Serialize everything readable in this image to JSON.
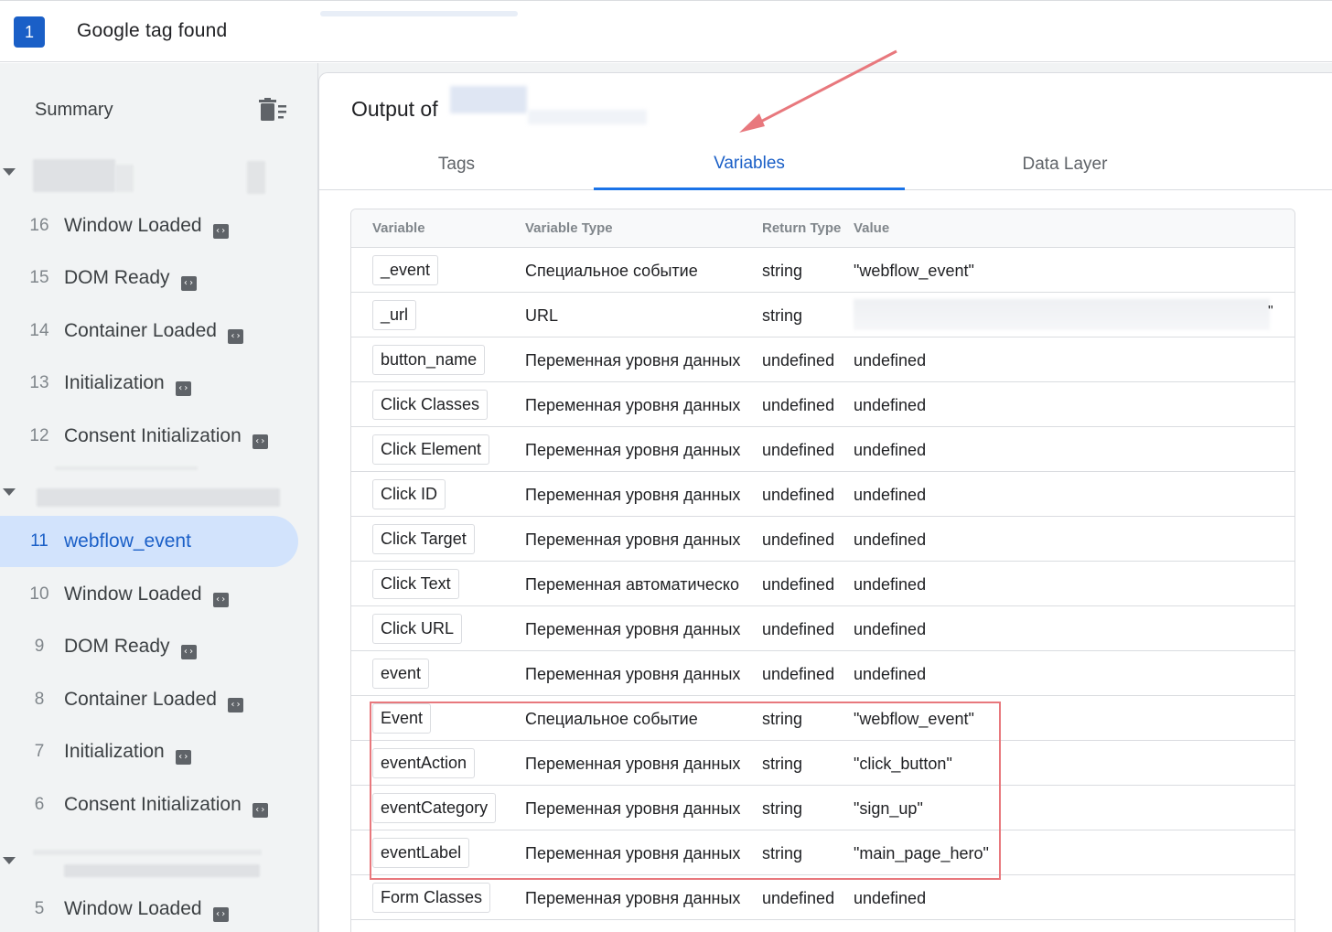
{
  "header": {
    "badge": "1",
    "title": "Google tag found"
  },
  "sidebar": {
    "summary_label": "Summary",
    "events": [
      {
        "num": "16",
        "name": "Window Loaded",
        "icon": "tag-icon"
      },
      {
        "num": "15",
        "name": "DOM Ready",
        "icon": "tag-icon"
      },
      {
        "num": "14",
        "name": "Container Loaded",
        "icon": "tag-icon"
      },
      {
        "num": "13",
        "name": "Initialization",
        "icon": "tag-icon"
      },
      {
        "num": "12",
        "name": "Consent Initialization",
        "icon": "tag-icon"
      },
      {
        "num": "11",
        "name": "webflow_event",
        "selected": true
      },
      {
        "num": "10",
        "name": "Window Loaded",
        "icon": "tag-icon"
      },
      {
        "num": "9",
        "name": "DOM Ready",
        "icon": "tag-icon"
      },
      {
        "num": "8",
        "name": "Container Loaded",
        "icon": "tag-icon"
      },
      {
        "num": "7",
        "name": "Initialization",
        "icon": "tag-icon"
      },
      {
        "num": "6",
        "name": "Consent Initialization",
        "icon": "tag-icon"
      },
      {
        "num": "5",
        "name": "Window Loaded",
        "icon": "tag-icon"
      }
    ]
  },
  "main": {
    "output_title": "Output of",
    "tabs": [
      {
        "label": "Tags",
        "active": false
      },
      {
        "label": "Variables",
        "active": true
      },
      {
        "label": "Data Layer",
        "active": false
      }
    ],
    "table": {
      "headers": {
        "variable": "Variable",
        "type": "Variable Type",
        "return_type": "Return Type",
        "value": "Value"
      },
      "rows": [
        {
          "name": "_event",
          "type": "Специальное событие",
          "ret": "string",
          "value": "\"webflow_event\""
        },
        {
          "name": "_url",
          "type": "URL",
          "ret": "string",
          "value": ""
        },
        {
          "name": "button_name",
          "type": "Переменная уровня данных",
          "ret": "undefined",
          "value": "undefined"
        },
        {
          "name": "Click Classes",
          "type": "Переменная уровня данных",
          "ret": "undefined",
          "value": "undefined"
        },
        {
          "name": "Click Element",
          "type": "Переменная уровня данных",
          "ret": "undefined",
          "value": "undefined"
        },
        {
          "name": "Click ID",
          "type": "Переменная уровня данных",
          "ret": "undefined",
          "value": "undefined"
        },
        {
          "name": "Click Target",
          "type": "Переменная уровня данных",
          "ret": "undefined",
          "value": "undefined"
        },
        {
          "name": "Click Text",
          "type": "Переменная автоматическо",
          "ret": "undefined",
          "value": "undefined"
        },
        {
          "name": "Click URL",
          "type": "Переменная уровня данных",
          "ret": "undefined",
          "value": "undefined"
        },
        {
          "name": "event",
          "type": "Переменная уровня данных",
          "ret": "undefined",
          "value": "undefined"
        },
        {
          "name": "Event",
          "type": "Специальное событие",
          "ret": "string",
          "value": "\"webflow_event\""
        },
        {
          "name": "eventAction",
          "type": "Переменная уровня данных",
          "ret": "string",
          "value": "\"click_button\""
        },
        {
          "name": "eventCategory",
          "type": "Переменная уровня данных",
          "ret": "string",
          "value": "\"sign_up\""
        },
        {
          "name": "eventLabel",
          "type": "Переменная уровня данных",
          "ret": "string",
          "value": "\"main_page_hero\""
        },
        {
          "name": "Form Classes",
          "type": "Переменная уровня данных",
          "ret": "undefined",
          "value": "undefined"
        }
      ],
      "url_tail": "\""
    }
  },
  "colors": {
    "accent": "#1a73e8",
    "highlight": "#e8787d",
    "selected_bg": "#d2e3fc"
  }
}
